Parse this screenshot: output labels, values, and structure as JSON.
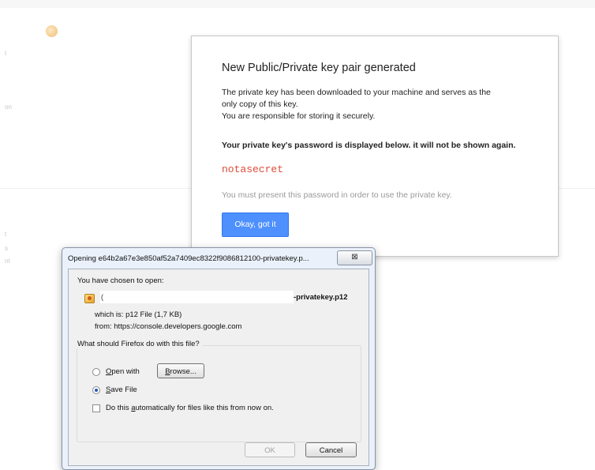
{
  "background": {
    "fragments": [
      "t",
      "on",
      "t",
      "s",
      "nt"
    ]
  },
  "google_dialog": {
    "title": "New Public/Private key pair generated",
    "body_lines": [
      "The private key has been downloaded to your machine and serves as the",
      "only copy of this key.",
      "You are responsible for storing it securely."
    ],
    "password_warning": "Your private key's password is displayed below. it will not be shown again.",
    "password": "notasecret",
    "note": "You must present this password in order to use the private key.",
    "ok_button": "Okay, got it",
    "colors": {
      "button": "#4d90fe",
      "password": "#dd4b39"
    }
  },
  "firefox_dialog": {
    "title": "Opening e64b2a67e3e850af52a7409ec8322f9086812100-privatekey.p...",
    "close_symbol": "⊠",
    "chosen_label": "You have chosen to open:",
    "file_name_prefix": "(",
    "file_name_suffix": "-privatekey.p12",
    "which_is": "which is:  p12 File (1,7 KB)",
    "from": "from:  https://console.developers.google.com",
    "question": "What should Firefox do with this file?",
    "open_with": {
      "mnemonic": "O",
      "rest": "pen with"
    },
    "browse_button": {
      "mnemonic": "B",
      "rest": "rowse..."
    },
    "save_file": {
      "mnemonic": "S",
      "rest": "ave File"
    },
    "auto": {
      "before": "Do this ",
      "mnemonic": "a",
      "after": "utomatically for files like this from now on."
    },
    "ok_button": "OK",
    "cancel_button": "Cancel",
    "selected_option": "save_file",
    "auto_checked": false
  }
}
